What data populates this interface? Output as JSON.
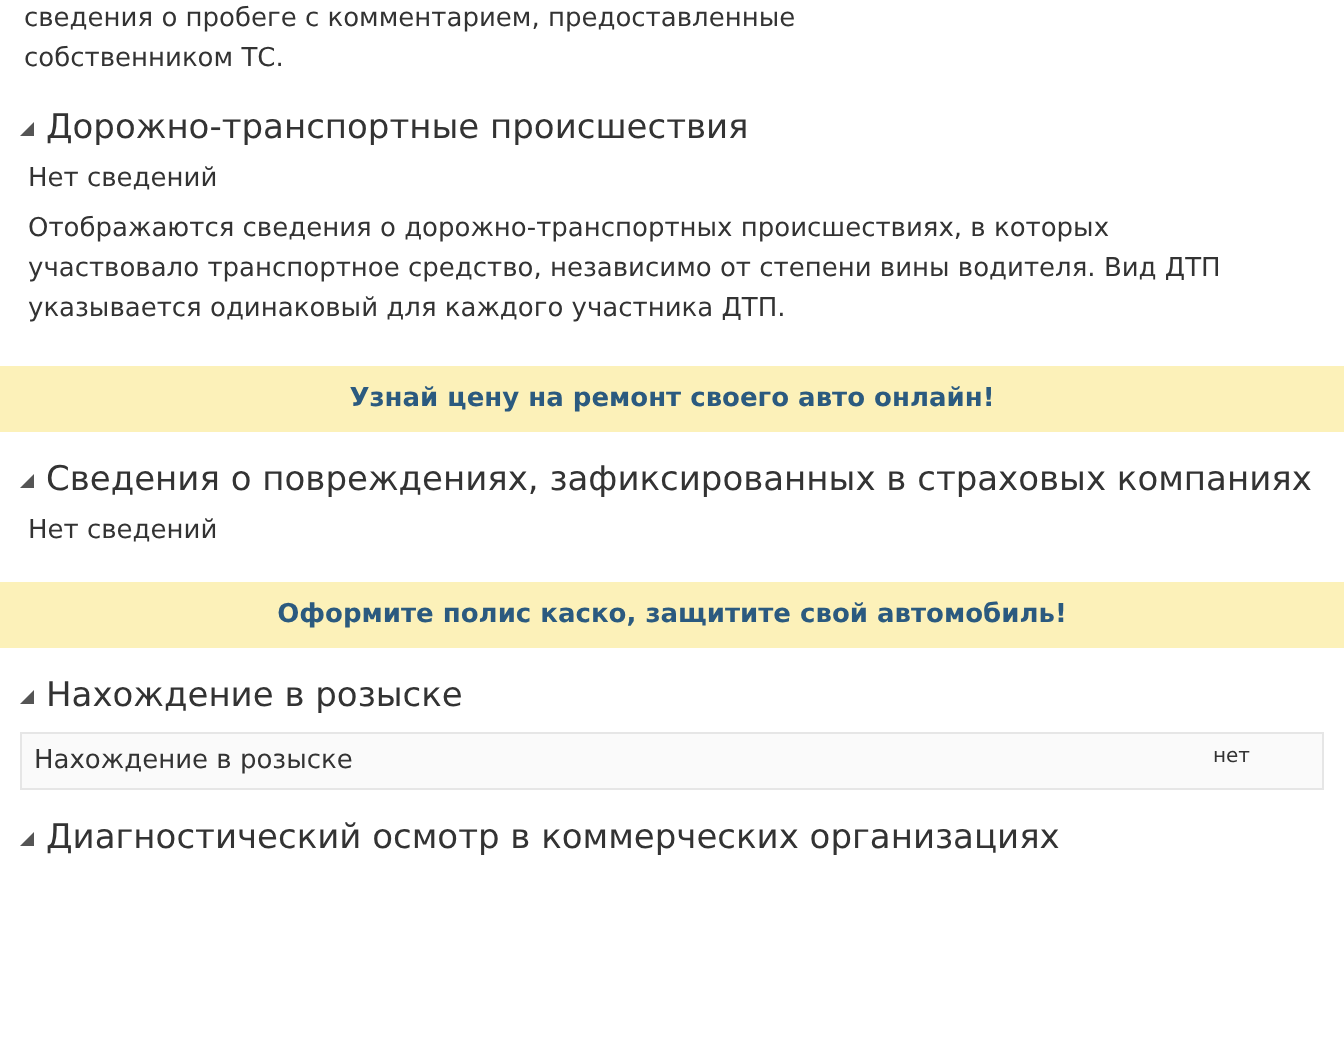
{
  "intro_text": "сведения о пробеге с комментарием, предоставленные собственником ТС.",
  "blocks": [
    {
      "kind": "section",
      "title": "Дорожно-транспортные происшествия",
      "expanded": true,
      "status": "Нет сведений",
      "note": "Отображаются сведения о дорожно-транспортных происшествиях, в которых участвовало транспортное средство, независимо от степени вины водителя. Вид ДТП указывается одинаковый для каждого участника ДТП."
    },
    {
      "kind": "banner",
      "text": "Узнай цену на ремонт своего авто онлайн!"
    },
    {
      "kind": "section",
      "title": "Сведения о повреждениях, зафиксированных в страховых компаниях",
      "expanded": true,
      "status": "Нет сведений"
    },
    {
      "kind": "banner",
      "text": "Оформите полис каско, защитите свой автомобиль!"
    },
    {
      "kind": "section",
      "title": "Нахождение в розыске",
      "expanded": true,
      "rows": [
        {
          "label": "Нахождение в розыске",
          "value": "нет"
        }
      ]
    },
    {
      "kind": "section",
      "title": "Диагностический осмотр в коммерческих организациях",
      "expanded": true
    }
  ]
}
